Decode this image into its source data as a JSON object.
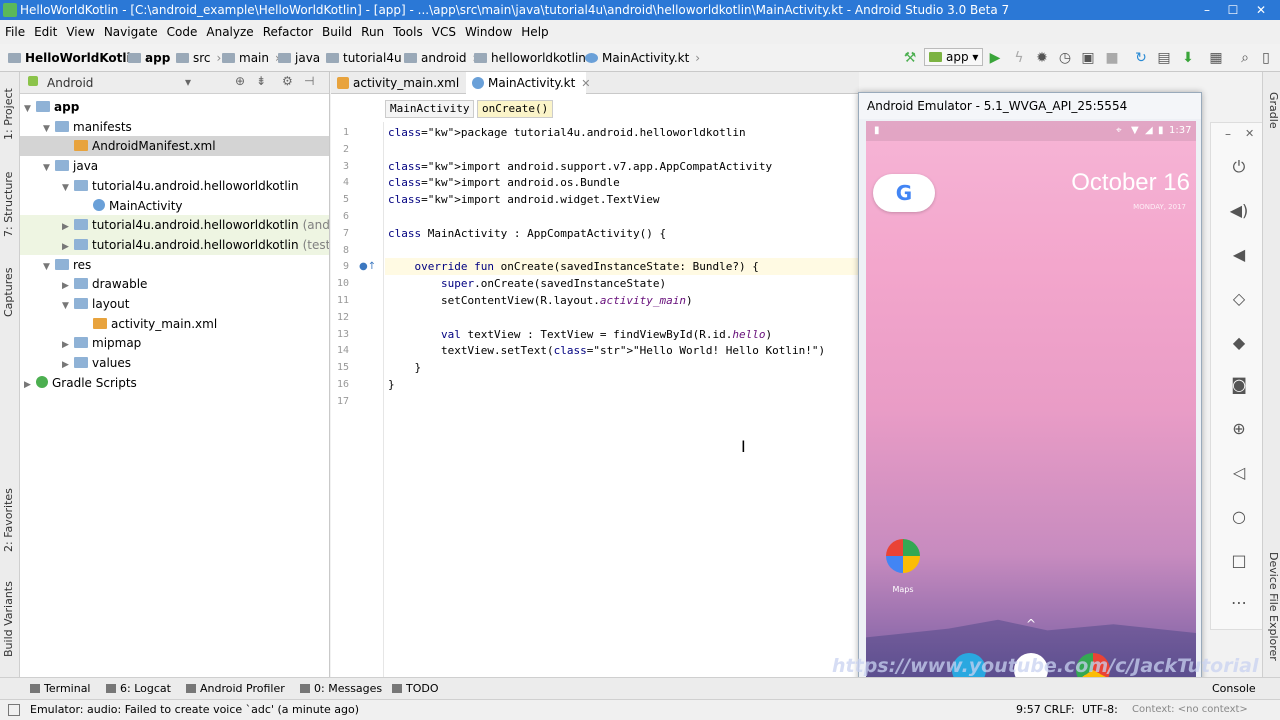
{
  "window": {
    "title": "HelloWorldKotlin - [C:\\android_example\\HelloWorldKotlin] - [app] - ...\\app\\src\\main\\java\\tutorial4u\\android\\helloworldkotlin\\MainActivity.kt - Android Studio 3.0 Beta 7",
    "controls": [
      "–",
      "☐",
      "✕"
    ]
  },
  "menu": [
    "File",
    "Edit",
    "View",
    "Navigate",
    "Code",
    "Analyze",
    "Refactor",
    "Build",
    "Run",
    "Tools",
    "VCS",
    "Window",
    "Help"
  ],
  "breadcrumbs": [
    "HelloWorldKotlin",
    "app",
    "src",
    "main",
    "java",
    "tutorial4u",
    "android",
    "helloworldkotlin",
    "MainActivity.kt"
  ],
  "run_config": "app",
  "left_tabs": [
    "1: Project",
    "7: Structure",
    "Captures",
    "2: Favorites",
    "Build Variants"
  ],
  "right_tabs": [
    "Gradle",
    "Device File Explorer"
  ],
  "project": {
    "view_mode": "Android",
    "tree": [
      {
        "label": "app",
        "bold": true,
        "depth": 0,
        "arrow": "▼"
      },
      {
        "label": "manifests",
        "depth": 1,
        "arrow": "▼"
      },
      {
        "label": "AndroidManifest.xml",
        "depth": 2,
        "arrow": "",
        "selected": true
      },
      {
        "label": "java",
        "depth": 1,
        "arrow": "▼"
      },
      {
        "label": "tutorial4u.android.helloworldkotlin",
        "depth": 2,
        "arrow": "▼"
      },
      {
        "label": "MainActivity",
        "depth": 3,
        "arrow": ""
      },
      {
        "label": "tutorial4u.android.helloworldkotlin",
        "suffix": "(androidTest)",
        "depth": 2,
        "arrow": "▶",
        "green": true
      },
      {
        "label": "tutorial4u.android.helloworldkotlin",
        "suffix": "(test)",
        "depth": 2,
        "arrow": "▶",
        "green": true
      },
      {
        "label": "res",
        "depth": 1,
        "arrow": "▼"
      },
      {
        "label": "drawable",
        "depth": 2,
        "arrow": "▶"
      },
      {
        "label": "layout",
        "depth": 2,
        "arrow": "▼"
      },
      {
        "label": "activity_main.xml",
        "depth": 3,
        "arrow": ""
      },
      {
        "label": "mipmap",
        "depth": 2,
        "arrow": "▶"
      },
      {
        "label": "values",
        "depth": 2,
        "arrow": "▶"
      },
      {
        "label": "Gradle Scripts",
        "depth": 0,
        "arrow": "▶"
      }
    ]
  },
  "editor": {
    "tabs": [
      {
        "label": "activity_main.xml",
        "active": false
      },
      {
        "label": "MainActivity.kt",
        "active": true
      }
    ],
    "structure_crumbs": [
      "MainActivity",
      "onCreate()"
    ],
    "line_numbers": [
      "1",
      "2",
      "3",
      "4",
      "5",
      "6",
      "7",
      "8",
      "9",
      "10",
      "11",
      "12",
      "13",
      "14",
      "15",
      "16",
      "17"
    ],
    "lines": [
      "package tutorial4u.android.helloworldkotlin",
      "",
      "import android.support.v7.app.AppCompatActivity",
      "import android.os.Bundle",
      "import android.widget.TextView",
      "",
      "class MainActivity : AppCompatActivity() {",
      "",
      "    override fun onCreate(savedInstanceState: Bundle?) {",
      "        super.onCreate(savedInstanceState)",
      "        setContentView(R.layout.activity_main)",
      "",
      "        val textView : TextView = findViewById(R.id.hello)",
      "        textView.setText(\"Hello World! Hello Kotlin!\")",
      "    }",
      "}",
      ""
    ]
  },
  "emulator": {
    "title": "Android Emulator - 5.1_WVGA_API_25:5554",
    "time": "1:37",
    "date": "October 16",
    "date_sub": "MONDAY, 2017",
    "maps_label": "Maps",
    "panel_controls": [
      "–",
      "✕"
    ]
  },
  "bottom_tools": [
    "Terminal",
    "6: Logcat",
    "Android Profiler",
    "0: Messages",
    "TODO",
    "Console"
  ],
  "status": {
    "message": "Emulator: audio: Failed to create voice `adc' (a minute ago)",
    "position": "9:57",
    "line_sep": "CRLF:",
    "encoding": "UTF-8:",
    "context": "Context: <no context>"
  },
  "watermark": "https://www.youtube.com/c/JackTutorial",
  "colors": {
    "titlebar": "#2b78d6",
    "keyword": "#000080",
    "string": "#008000",
    "selection": "#d4d4d4"
  }
}
